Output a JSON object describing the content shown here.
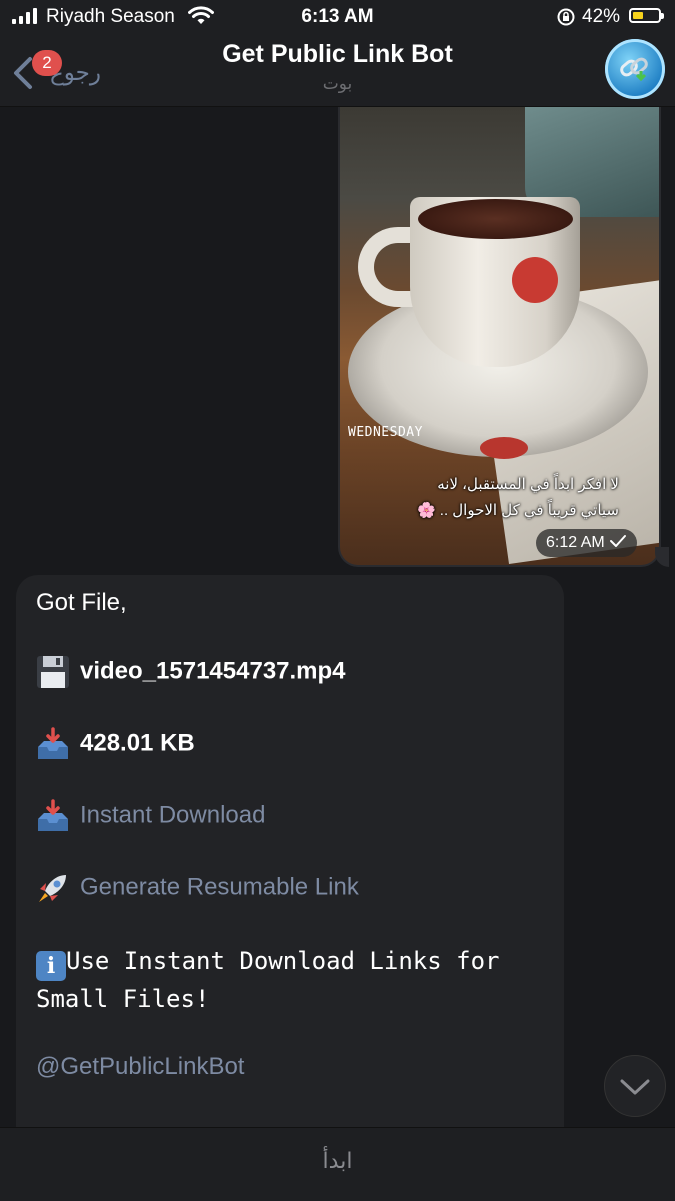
{
  "status_bar": {
    "carrier": "Riyadh Season",
    "time": "6:13 AM",
    "battery_percent": "42%",
    "battery_level": 0.42
  },
  "nav": {
    "back_label": "رجوع",
    "back_badge": "2",
    "title": "Get Public Link Bot",
    "subtitle": "بوت"
  },
  "photo_message": {
    "overlay_day": "WEDNESDAY",
    "caption_line1": "لا افكر ابداً في المستقبل، لانه",
    "caption_line2": "سياتي قريباً في كل الاحوال .. 🌸",
    "time": "6:12 AM"
  },
  "bot_message": {
    "got_file": "Got File,",
    "file_name": "video_1571454737.mp4",
    "file_size": "428.01 KB",
    "instant_download": "Instant Download",
    "resumable_link": "Generate Resumable Link",
    "tip": "Use Instant Download Links for Small Files!",
    "bot_handle": "@GetPublicLinkBot"
  },
  "bottom_bar": {
    "start_label": "ابدأ"
  }
}
